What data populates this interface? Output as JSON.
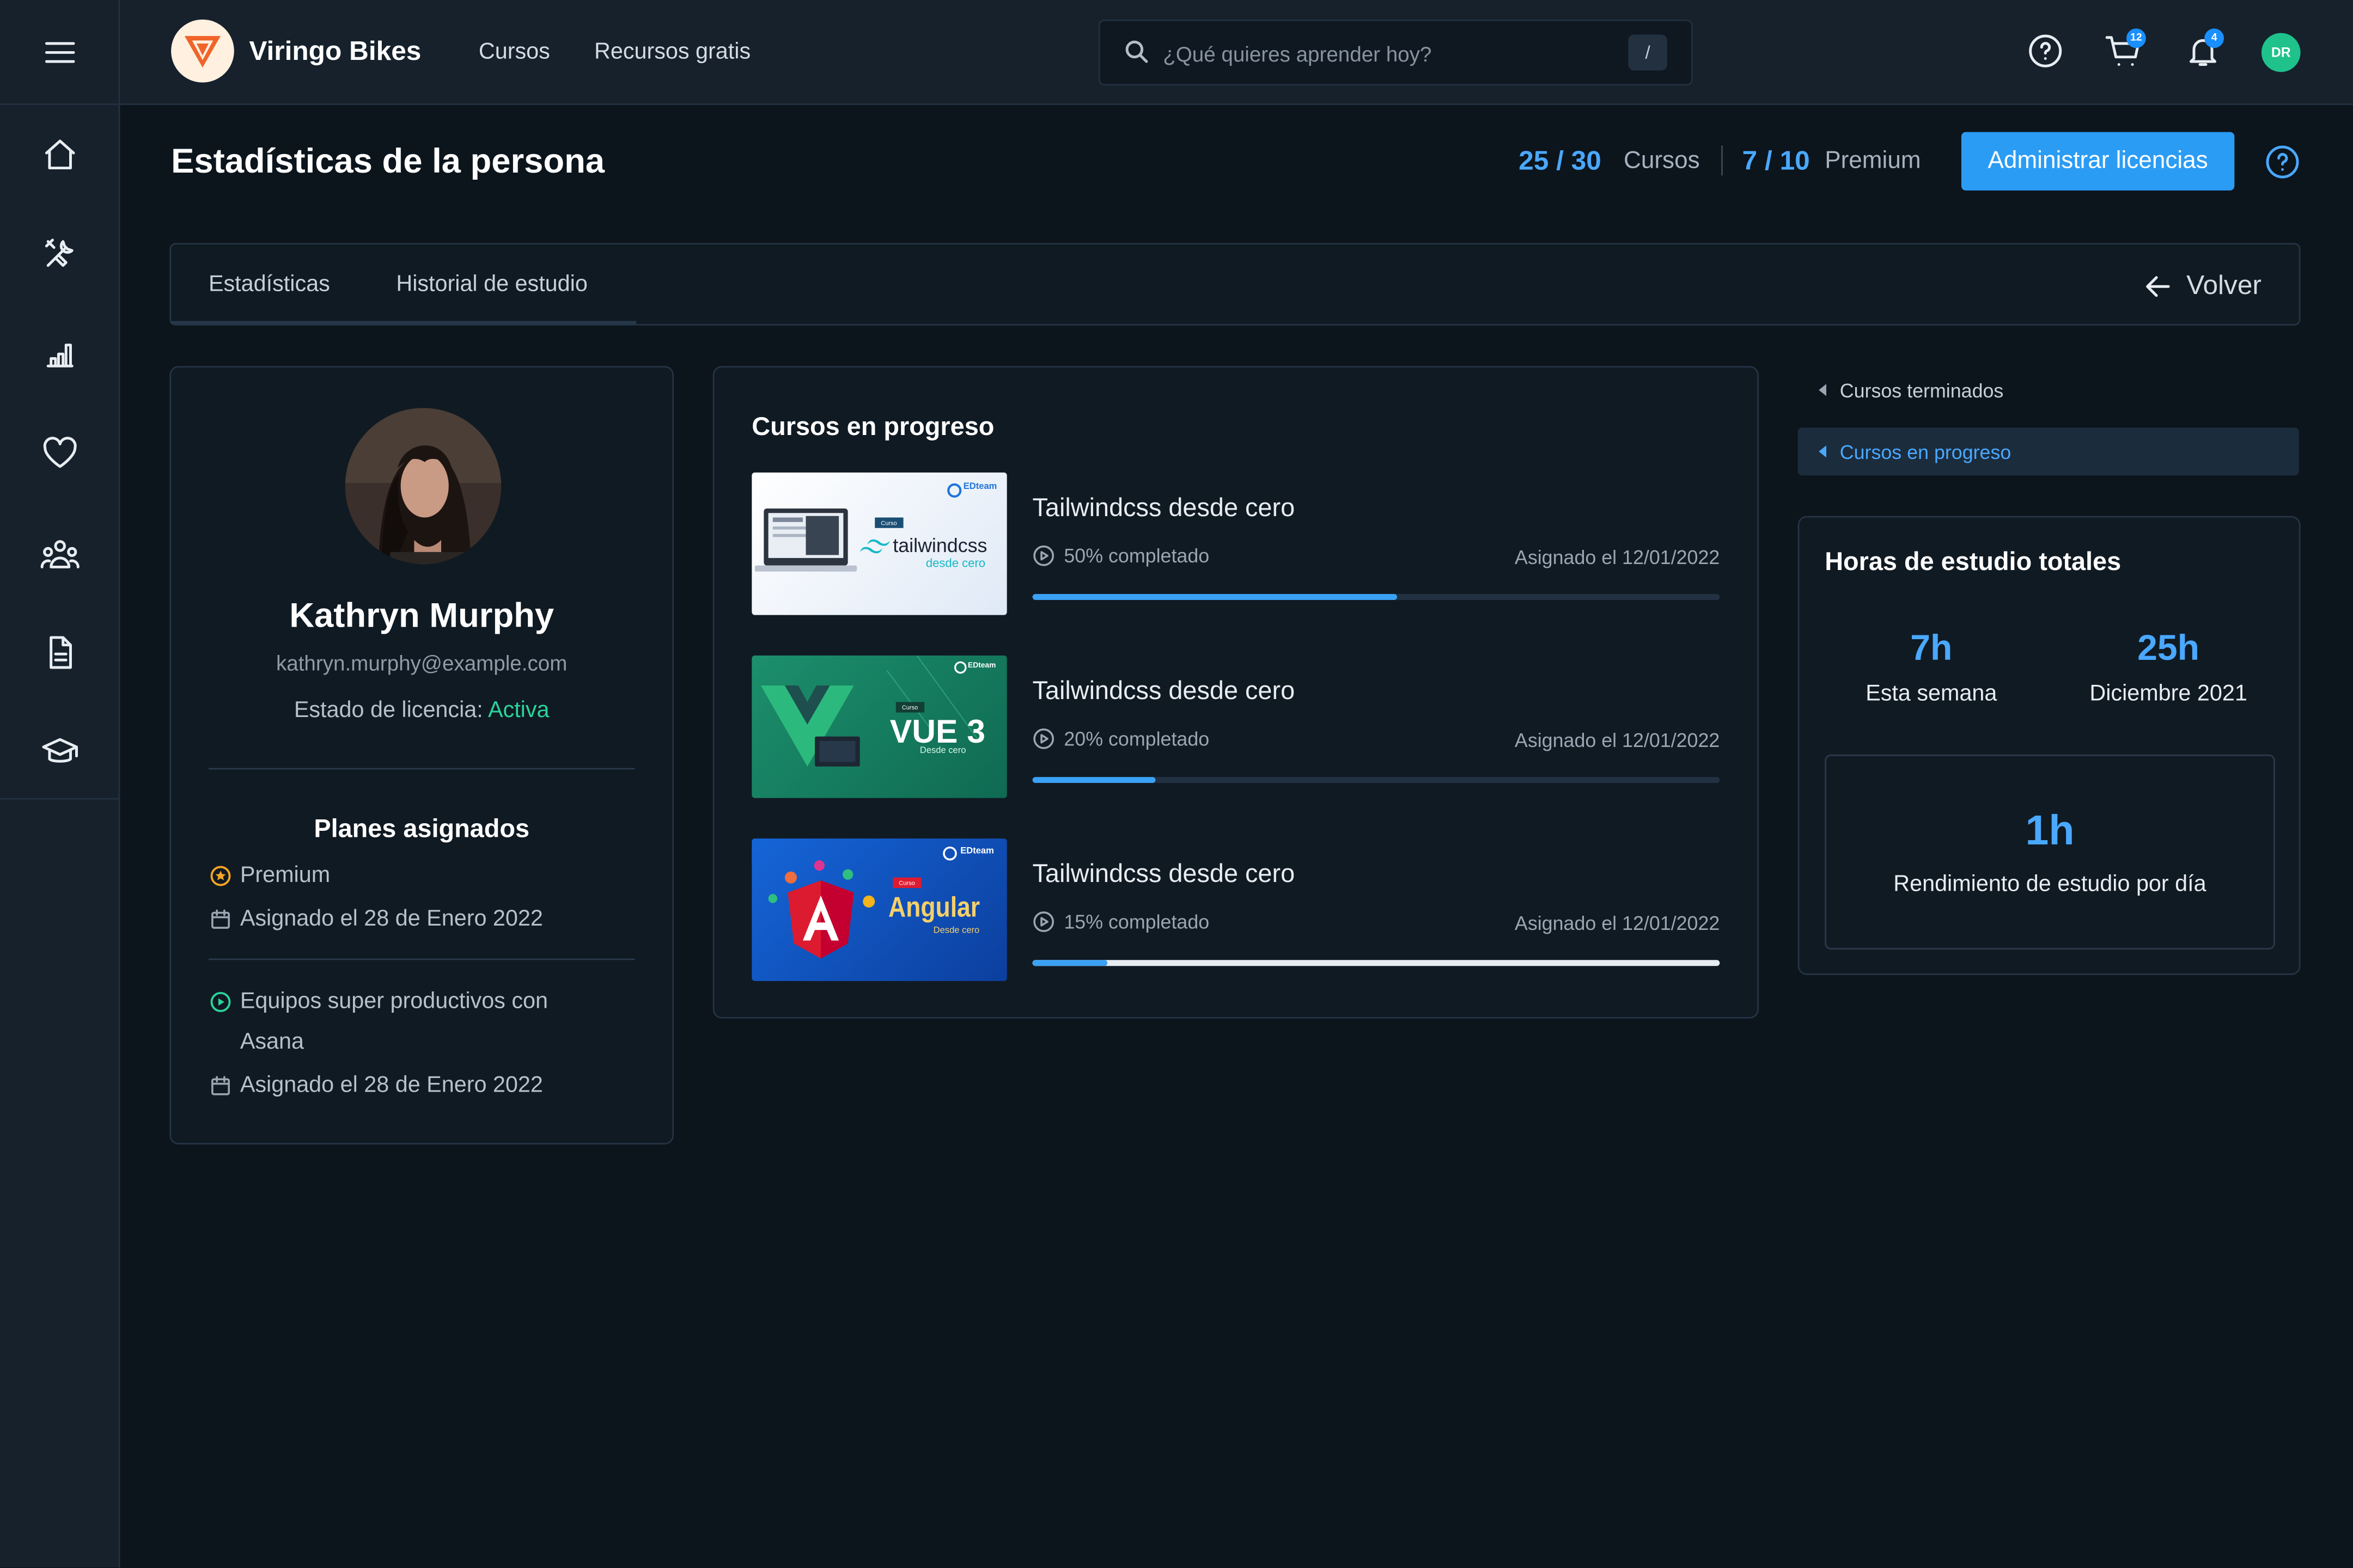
{
  "topbar": {
    "brand": "Viringo Bikes",
    "nav": [
      "Cursos",
      "Recursos gratis"
    ],
    "search_placeholder": "¿Qué quieres aprender hoy?",
    "search_shortcut": "/",
    "cart_count": "12",
    "notifications_count": "4",
    "user_initials": "DR"
  },
  "header": {
    "title": "Estadísticas de la persona",
    "courses_used": "25 / 30",
    "courses_label": "Cursos",
    "premium_used": "7 / 10",
    "premium_label": "Premium",
    "admin_button": "Administrar licencias"
  },
  "tabs": {
    "items": [
      "Estadísticas",
      "Historial de estudio"
    ],
    "back": "Volver"
  },
  "profile": {
    "name": "Kathryn Murphy",
    "email": "kathryn.murphy@example.com",
    "license_label": "Estado de licencia:",
    "license_status": "Activa",
    "plans_title": "Planes asignados",
    "plans": [
      {
        "name": "Premium",
        "assigned": "Asignado el 28 de Enero 2022"
      },
      {
        "name": "Equipos super productivos con Asana",
        "assigned": "Asignado el 28 de Enero 2022"
      }
    ]
  },
  "progress": {
    "title": "Cursos en progreso",
    "courses": [
      {
        "title": "Tailwindcss desde cero",
        "completed": "50% completado",
        "percent": 53,
        "assigned": "Asignado el 12/01/2022",
        "thumb_label": "tailwindcss",
        "thumb_sub": "desde cero"
      },
      {
        "title": "Tailwindcss desde cero",
        "completed": "20% completado",
        "percent": 18,
        "assigned": "Asignado el 12/01/2022",
        "thumb_label": "VUE 3",
        "thumb_sub": "Desde cero"
      },
      {
        "title": "Tailwindcss desde cero",
        "completed": "15% completado",
        "percent": 11,
        "assigned": "Asignado el 12/01/2022",
        "thumb_label": "Angular",
        "thumb_sub": "Desde cero"
      }
    ],
    "thumb_brand": "EDteam",
    "thumb_tag": "Curso"
  },
  "right": {
    "link_finished": "Cursos terminados",
    "link_progress": "Cursos en progreso",
    "hours_title": "Horas de estudio totales",
    "week_value": "7h",
    "week_label": "Esta semana",
    "month_value": "25h",
    "month_label": "Diciembre 2021",
    "daily_value": "1h",
    "daily_label": "Rendimiento de estudio por día"
  },
  "colors": {
    "accent": "#2b9cf4",
    "active_green": "#2bd49a",
    "background": "#0c141c"
  }
}
